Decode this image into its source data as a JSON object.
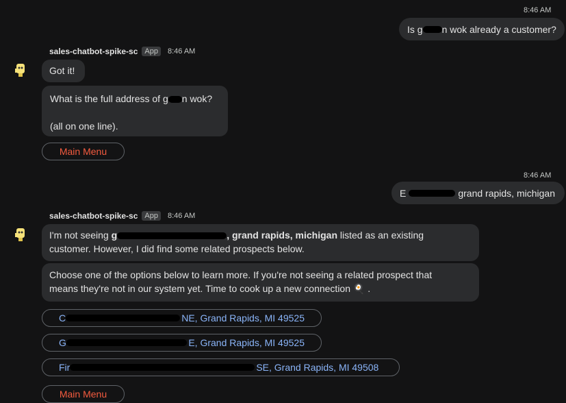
{
  "messages": {
    "user1": {
      "time": "8:46 AM",
      "text_start": "Is g",
      "text_end": "n wok already a customer?"
    },
    "bot1": {
      "sender": "sales-chatbot-spike-sc",
      "badge": "App",
      "time": "8:46 AM",
      "bubble1": "Got it!",
      "bubble2_line1_start": "What is the full address of g",
      "bubble2_line1_end": "n wok?",
      "bubble2_line2": "(all on one line).",
      "menu_button": "Main Menu"
    },
    "user2": {
      "time": "8:46 AM",
      "text_start": "E",
      "text_end": "grand rapids, michigan"
    },
    "bot2": {
      "sender": "sales-chatbot-spike-sc",
      "badge": "App",
      "time": "8:46 AM",
      "p1_start": "I'm not seeing ",
      "p1_bold_start": "g",
      "p1_bold_end": ", grand rapids, michigan",
      "p1_rest": " listed as an existing",
      "p1_line2": "customer. However, I did find some related prospects below.",
      "p2_line1": "Choose one of the options below to learn more. If you're not seeing a related prospect that",
      "p2_line2": "means they're not in our system yet. Time to cook up a new connection",
      "p2_emoji": "🍳",
      "p2_end": ".",
      "prospects": [
        {
          "start": "C",
          "end": "NE, Grand Rapids, MI 49525"
        },
        {
          "start": "G",
          "end": "E, Grand Rapids, MI 49525"
        },
        {
          "start": "Fir",
          "end": "SE, Grand Rapids, MI 49508"
        }
      ],
      "menu_button": "Main Menu"
    }
  }
}
